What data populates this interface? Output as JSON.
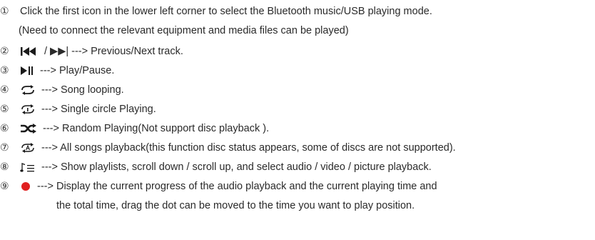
{
  "items": [
    {
      "number": "①",
      "text": "Click the first icon in the lower left corner to select the Bluetooth music/USB playing mode.",
      "continuation": "(Need to connect the relevant equipment and media files can be played)"
    },
    {
      "number": "②",
      "icon": "previous-next-track-icon",
      "text": "/ ▶▶| ---> Previous/Next track."
    },
    {
      "number": "③",
      "icon": "play-pause-icon",
      "text": "---> Play/Pause."
    },
    {
      "number": "④",
      "icon": "song-loop-icon",
      "text": "---> Song looping."
    },
    {
      "number": "⑤",
      "icon": "single-loop-icon",
      "text": "---> Single circle Playing."
    },
    {
      "number": "⑥",
      "icon": "shuffle-icon",
      "text": "---> Random Playing(Not support disc playback )."
    },
    {
      "number": "⑦",
      "icon": "all-songs-loop-icon",
      "text": "---> All songs playback(this function disc status appears, some of discs are not supported)."
    },
    {
      "number": "⑧",
      "icon": "playlist-icon",
      "text": "---> Show playlists, scroll down / scroll up, and select audio / video / picture playback."
    },
    {
      "number": "⑨",
      "icon": "progress-dot-icon",
      "icon_color": "#e02020",
      "text": "---> Display the current progress of the audio playback and the current playing time and",
      "continuation": "the total time, drag the dot can be moved to the time you want to play position."
    }
  ]
}
